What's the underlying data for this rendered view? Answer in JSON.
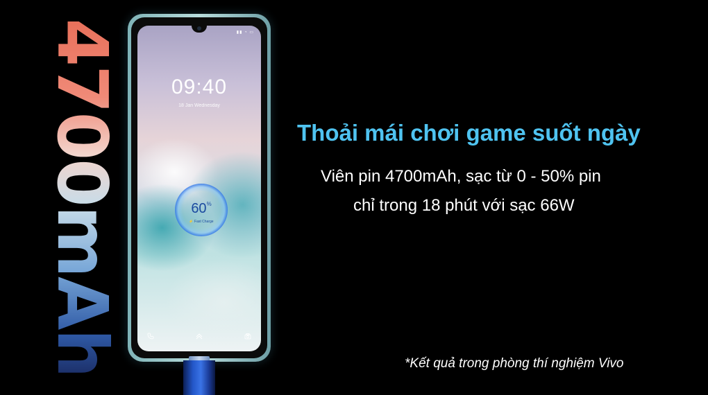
{
  "battery_badge": {
    "text": "4700mAh"
  },
  "phone": {
    "status_icons": "▮▮ ◔ ▭",
    "clock_time": "09:40",
    "clock_date": "18 Jan  Wednesday",
    "charge_percent": "60",
    "charge_unit": "%",
    "charge_label": "⚡ Fast Charge"
  },
  "headline": "Thoải mái chơi game suốt ngày",
  "description": {
    "line1": "Viên pin 4700mAh, sạc từ 0 - 50% pin",
    "line2": "chỉ trong 18 phút với sạc 66W"
  },
  "footnote": "*Kết quả trong phòng thí nghiệm Vivo",
  "colors": {
    "background": "#000000",
    "headline": "#4fc3f0",
    "body_text": "#ffffff"
  },
  "icons": [
    "phone-call-icon",
    "swipe-up-icon",
    "camera-icon",
    "fast-charge-icon"
  ]
}
